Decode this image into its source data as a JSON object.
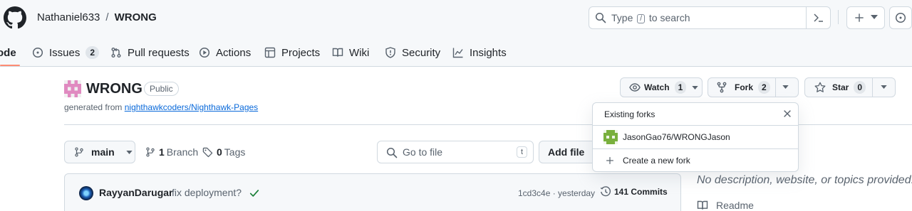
{
  "header": {
    "owner": "Nathaniel633",
    "separator": "/",
    "repo": "WRONG",
    "search_prefix": "Type",
    "search_key": "/",
    "search_suffix": "to search"
  },
  "nav": {
    "code": "ode",
    "issues": "Issues",
    "issues_count": "2",
    "pull_requests": "Pull requests",
    "actions": "Actions",
    "projects": "Projects",
    "wiki": "Wiki",
    "security": "Security",
    "insights": "Insights"
  },
  "repo": {
    "name": "WRONG",
    "visibility": "Public",
    "generated_prefix": "generated from",
    "template": "nighthawkcoders/Nighthawk-Pages"
  },
  "actions": {
    "watch_label": "Watch",
    "watch_count": "1",
    "fork_label": "Fork",
    "fork_count": "2",
    "star_label": "Star",
    "star_count": "0"
  },
  "files": {
    "branch": "main",
    "branch_count": "1",
    "branch_label": "Branch",
    "tag_count": "0",
    "tag_label": "Tags",
    "goto_placeholder": "Go to file",
    "goto_key": "t",
    "add_file": "Add file"
  },
  "commit": {
    "author": "RayyanDarugar",
    "message": "fix deployment?",
    "hash_time": "1cd3c4e · yesterday",
    "commits_label": "141 Commits"
  },
  "sidebar": {
    "about": "No description, website, or topics provided.",
    "readme": "Readme"
  },
  "forks_popover": {
    "heading": "Existing forks",
    "fork": "JasonGao76/WRONGJason",
    "create": "Create a new fork"
  },
  "colors": {
    "link": "#0969da",
    "success": "#1a7f37",
    "tab_underline": "#fd8c73"
  }
}
